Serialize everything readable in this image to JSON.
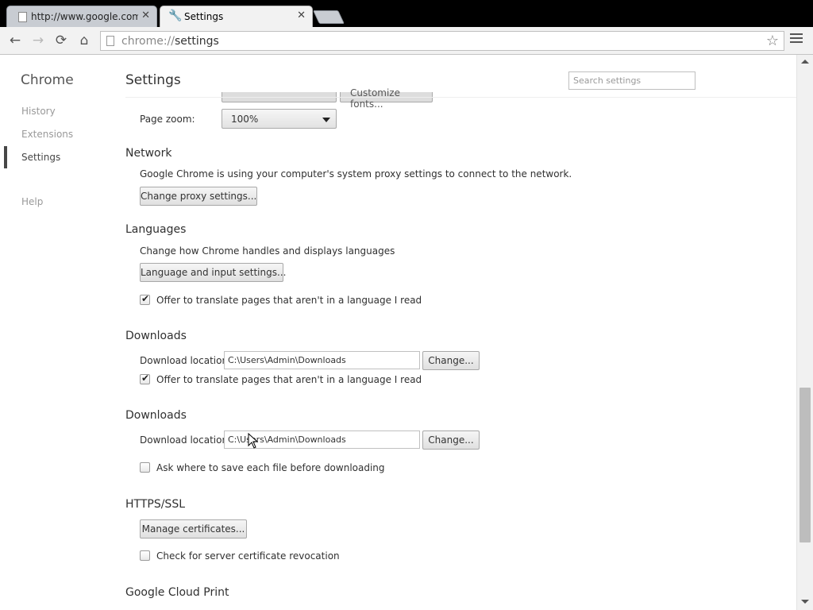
{
  "tabs": [
    {
      "title": "http://www.google.com/",
      "active": false
    },
    {
      "title": "Settings",
      "active": true
    }
  ],
  "toolbar": {
    "url_scheme": "chrome://",
    "url_path": "settings"
  },
  "sidebar": {
    "title": "Chrome",
    "items": [
      {
        "label": "History",
        "selected": false
      },
      {
        "label": "Extensions",
        "selected": false
      },
      {
        "label": "Settings",
        "selected": true
      },
      {
        "label": "Help",
        "selected": false
      }
    ]
  },
  "main": {
    "title": "Settings",
    "search_placeholder": "Search settings",
    "clipped_button": "Customize fonts...",
    "page_zoom": {
      "label": "Page zoom:",
      "value": "100%"
    },
    "network": {
      "title": "Network",
      "desc": "Google Chrome is using your computer's system proxy settings to connect to the network.",
      "button": "Change proxy settings..."
    },
    "languages": {
      "title": "Languages",
      "desc": "Change how Chrome handles and displays languages",
      "button": "Language and input settings...",
      "checkbox_label": "Offer to translate pages that aren't in a language I read",
      "checked": true
    },
    "downloads_1": {
      "title": "Downloads",
      "location_label": "Download location:",
      "location_value": "C:\\Users\\Admin\\Downloads",
      "change_button": "Change...",
      "checkbox_label": "Offer to translate pages that aren't in a language I read",
      "checked": true
    },
    "downloads_2": {
      "title": "Downloads",
      "location_label": "Download location:",
      "location_value": "C:\\Users\\Admin\\Downloads",
      "change_button": "Change...",
      "checkbox_label": "Ask where to save each file before downloading",
      "checked": false
    },
    "https": {
      "title": "HTTPS/SSL",
      "button": "Manage certificates...",
      "checkbox_label": "Check for server certificate revocation",
      "checked": false
    },
    "cloud_print": {
      "title": "Google Cloud Print"
    }
  },
  "colors": {
    "accent": "#464646",
    "tab_active": "#f2f2f2",
    "tab_inactive": "#c8ccd2"
  },
  "scroll": {
    "position_fraction": 0.72
  }
}
